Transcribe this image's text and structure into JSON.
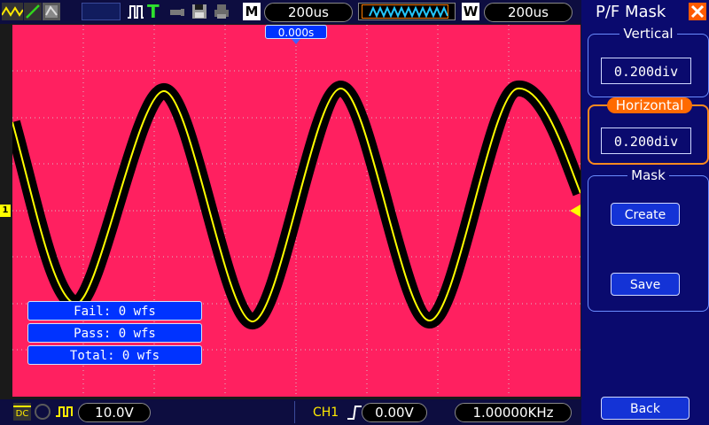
{
  "topbar": {
    "mode_letter": "M",
    "timebase": "200us",
    "window_letter": "W",
    "window_timebase": "200us",
    "trigger_position": "0.000s"
  },
  "panel": {
    "title": "P/F Mask",
    "vertical": {
      "label": "Vertical",
      "value": "0.200div"
    },
    "horizontal": {
      "label": "Horizontal",
      "value": "0.200div"
    },
    "mask": {
      "label": "Mask",
      "create_label": "Create",
      "save_label": "Save"
    },
    "back_label": "Back"
  },
  "display": {
    "channel_marker": "1",
    "fail": "Fail:  0 wfs",
    "pass": "Pass:  0 wfs",
    "total": "Total:  0 wfs"
  },
  "bottombar": {
    "coupling": "DC",
    "ch1_scale": "10.0V",
    "trigger_source": "CH1",
    "trigger_level": "0.00V",
    "frequency": "1.00000KHz"
  },
  "colors": {
    "screen": "#ff2060",
    "trace": "#ffff00",
    "mask": "#000000",
    "panel": "#0a0a6e",
    "highlight": "#ff6a00"
  }
}
